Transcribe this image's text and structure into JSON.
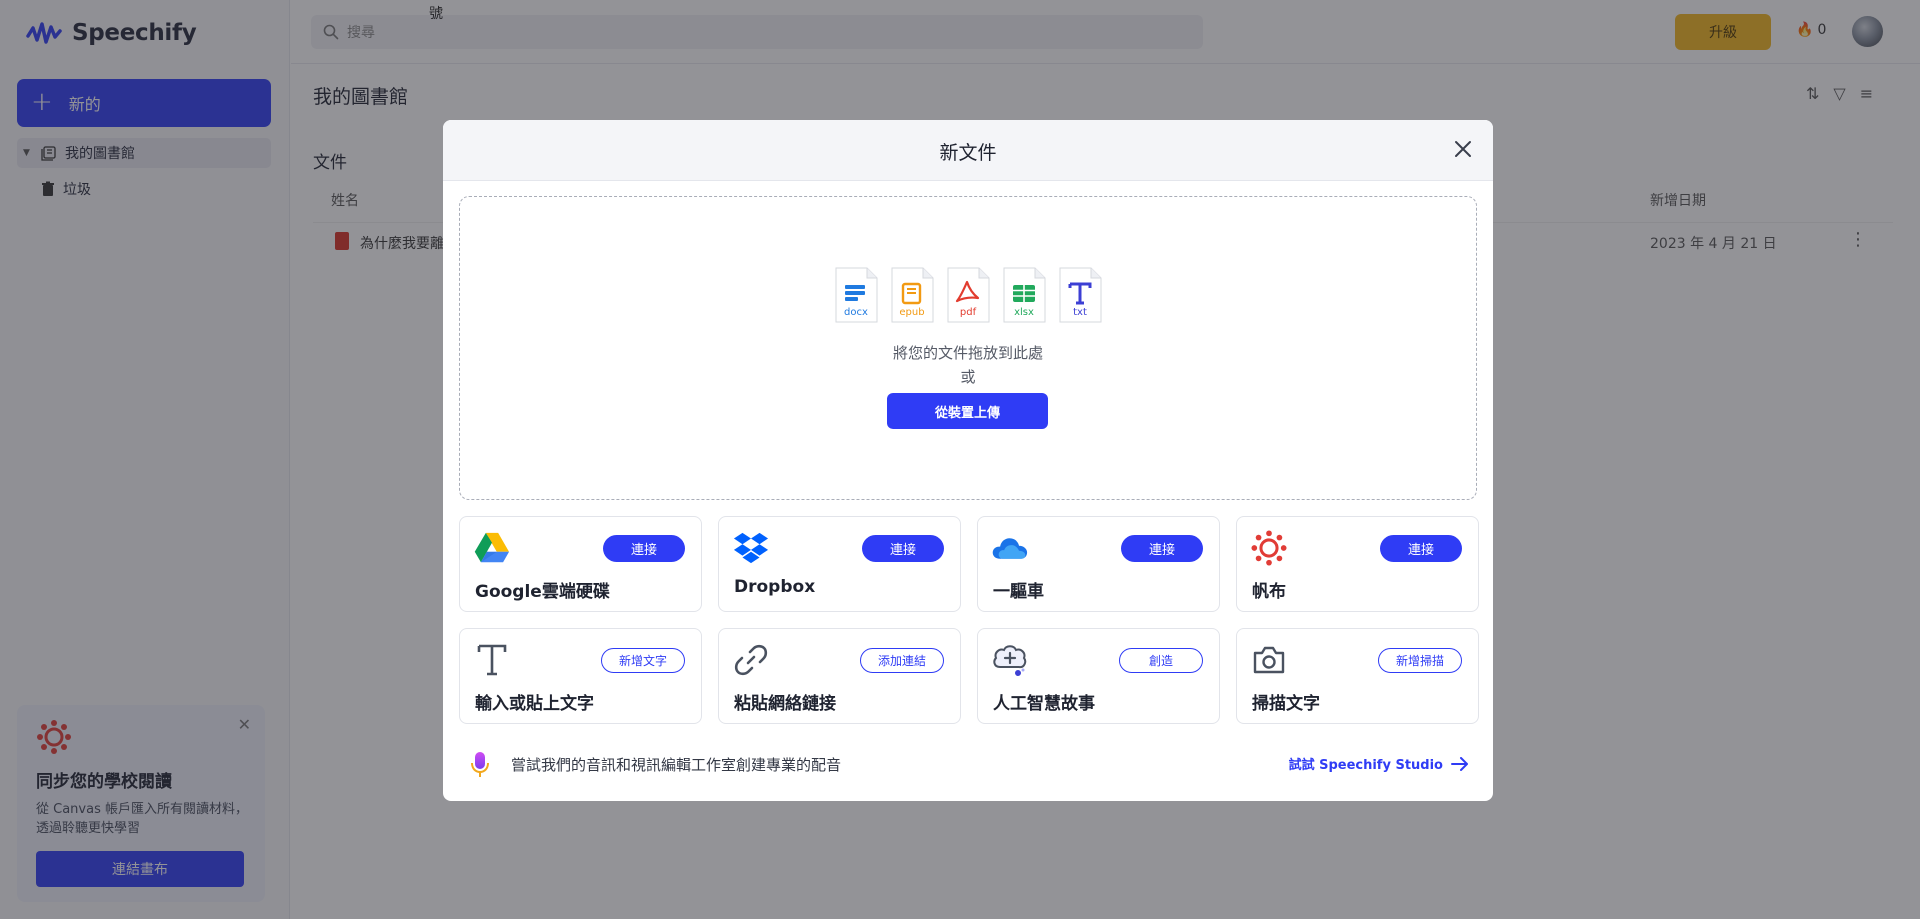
{
  "app": {
    "name": "Speechify",
    "new_button": "新的",
    "sidebar": {
      "items": [
        {
          "label": "我的圖書館"
        },
        {
          "label": "垃圾"
        }
      ]
    },
    "promo": {
      "title": "同步您的學校閱讀",
      "description": "從 Canvas 帳戶匯入所有閱讀材料，透過聆聽更快學習",
      "button": "連結畫布"
    },
    "search": {
      "placeholder": "搜尋"
    },
    "floating_char": "號",
    "upgrade": "升級",
    "streak_count": "0",
    "library": {
      "title": "我的圖書館",
      "section": "文件",
      "columns": {
        "name": "姓名",
        "date": "新增日期"
      },
      "rows": [
        {
          "name": "為什麼我要離",
          "date": "2023 年 4 月 21 日"
        }
      ]
    }
  },
  "modal": {
    "title": "新文件",
    "file_types": [
      "docx",
      "epub",
      "pdf",
      "xlsx",
      "txt"
    ],
    "drop_text": "將您的文件拖放到此處",
    "or_text": "或",
    "upload_button": "從裝置上傳",
    "integrations": [
      {
        "label": "Google雲端硬碟",
        "action": "連接",
        "icon": "google-drive-icon"
      },
      {
        "label": "Dropbox",
        "action": "連接",
        "icon": "dropbox-icon"
      },
      {
        "label": "一驅車",
        "action": "連接",
        "icon": "onedrive-icon"
      },
      {
        "label": "帆布",
        "action": "連接",
        "icon": "canvas-icon"
      }
    ],
    "tools": [
      {
        "label": "輸入或貼上文字",
        "action": "新增文字",
        "icon": "text-icon"
      },
      {
        "label": "粘貼網絡鏈接",
        "action": "添加連結",
        "icon": "link-icon"
      },
      {
        "label": "人工智慧故事",
        "action": "創造",
        "icon": "ai-story-icon"
      },
      {
        "label": "掃描文字",
        "action": "新增掃描",
        "icon": "camera-icon"
      }
    ],
    "footer": {
      "text": "嘗試我們的音訊和視訊編輯工作室創建專業的配音",
      "link": "試試 Speechify Studio"
    }
  },
  "colors": {
    "accent": "#2f3cf5",
    "upgrade": "#f3b61f",
    "overlay": "rgba(40,40,48,0.5)"
  }
}
